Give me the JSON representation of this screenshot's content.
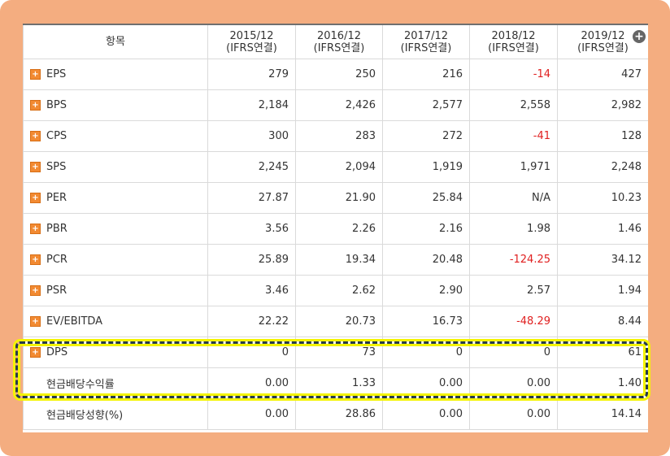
{
  "table": {
    "columns": [
      {
        "line1": "항목",
        "line2": ""
      },
      {
        "line1": "2015/12",
        "line2": "(IFRS연결)"
      },
      {
        "line1": "2016/12",
        "line2": "(IFRS연결)"
      },
      {
        "line1": "2017/12",
        "line2": "(IFRS연결)"
      },
      {
        "line1": "2018/12",
        "line2": "(IFRS연결)"
      },
      {
        "line1": "2019/12",
        "line2": "(IFRS연결)"
      }
    ],
    "rows": [
      {
        "label": "EPS",
        "values": [
          "279",
          "250",
          "216",
          "-14",
          "427"
        ]
      },
      {
        "label": "BPS",
        "values": [
          "2,184",
          "2,426",
          "2,577",
          "2,558",
          "2,982"
        ]
      },
      {
        "label": "CPS",
        "values": [
          "300",
          "283",
          "272",
          "-41",
          "128"
        ]
      },
      {
        "label": "SPS",
        "values": [
          "2,245",
          "2,094",
          "1,919",
          "1,971",
          "2,248"
        ]
      },
      {
        "label": "PER",
        "values": [
          "27.87",
          "21.90",
          "25.84",
          "N/A",
          "10.23"
        ]
      },
      {
        "label": "PBR",
        "values": [
          "3.56",
          "2.26",
          "2.16",
          "1.98",
          "1.46"
        ]
      },
      {
        "label": "PCR",
        "values": [
          "25.89",
          "19.34",
          "20.48",
          "-124.25",
          "34.12"
        ]
      },
      {
        "label": "PSR",
        "values": [
          "3.46",
          "2.62",
          "2.90",
          "2.57",
          "1.94"
        ]
      },
      {
        "label": "EV/EBITDA",
        "values": [
          "22.22",
          "20.73",
          "16.73",
          "-48.29",
          "8.44"
        ]
      },
      {
        "label": "DPS",
        "values": [
          "0",
          "73",
          "0",
          "0",
          "61"
        ]
      },
      {
        "label": "현금배당수익률",
        "values": [
          "0.00",
          "1.33",
          "0.00",
          "0.00",
          "1.40"
        ]
      },
      {
        "label": "현금배당성향(%)",
        "values": [
          "0.00",
          "28.86",
          "0.00",
          "0.00",
          "14.14"
        ]
      }
    ],
    "expand_icon": "plus-icon",
    "add_column_icon": "add-circle-icon"
  },
  "colors": {
    "frame": "#f4ad80",
    "negative": "#e02020",
    "expand_icon": "#f28a32",
    "highlight_border": "#263a4a",
    "highlight_glow": "#f4f400"
  }
}
